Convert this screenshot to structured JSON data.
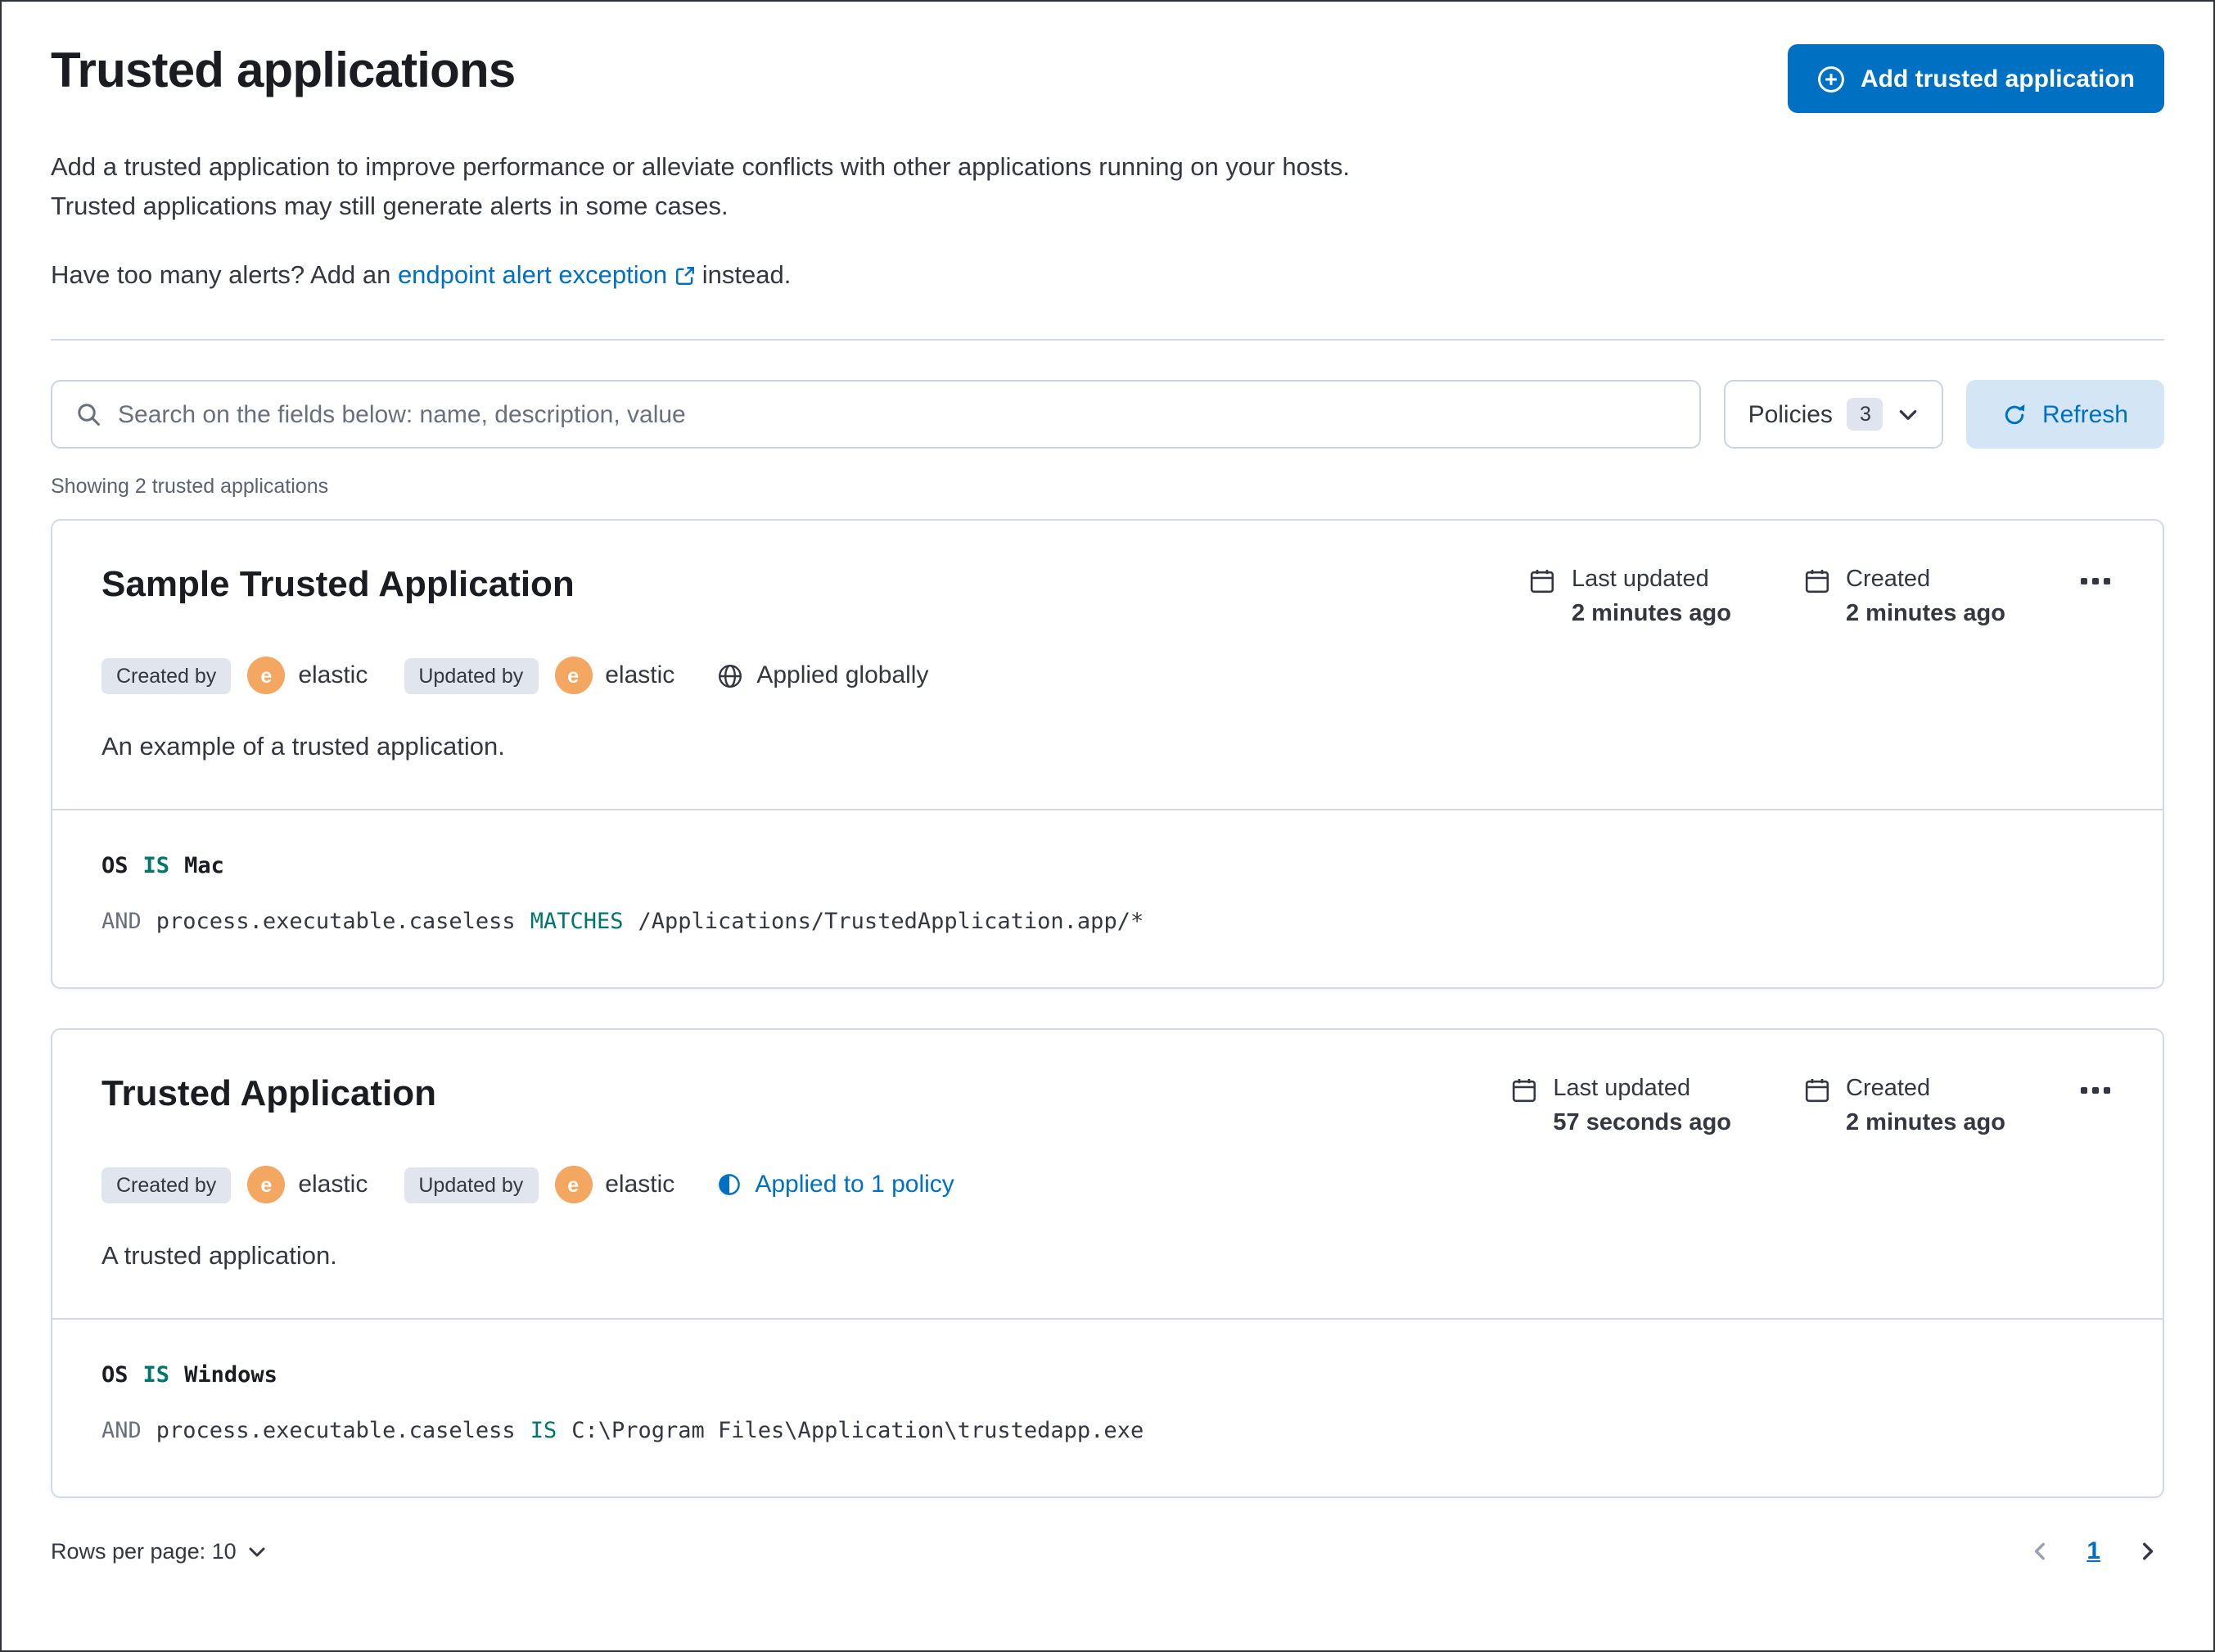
{
  "header": {
    "title": "Trusted applications",
    "add_button_label": "Add trusted application",
    "description": "Add a trusted application to improve performance or alleviate conflicts with other applications running on your hosts. Trusted applications may still generate alerts in some cases.",
    "alerts_line": {
      "prefix": "Have too many alerts? Add an ",
      "link_label": "endpoint alert exception",
      "suffix": " instead."
    }
  },
  "toolbar": {
    "search_placeholder": "Search on the fields below: name, description, value",
    "policies_label": "Policies",
    "policies_count": "3",
    "refresh_label": "Refresh"
  },
  "list": {
    "showing_text": "Showing 2 trusted applications"
  },
  "cards": [
    {
      "title": "Sample Trusted Application",
      "created_by_label": "Created by",
      "created_by_initial": "e",
      "created_by_user": "elastic",
      "updated_by_label": "Updated by",
      "updated_by_initial": "e",
      "updated_by_user": "elastic",
      "scope_label": "Applied globally",
      "last_updated_label": "Last updated",
      "last_updated_value": "2 minutes ago",
      "created_label": "Created",
      "created_value": "2 minutes ago",
      "description": "An example of a trusted application.",
      "conditions": [
        {
          "prefix": "",
          "field": "OS",
          "operator": "IS",
          "value": "Mac"
        },
        {
          "prefix": "AND",
          "field": "process.executable.caseless",
          "operator": "MATCHES",
          "value": "/Applications/TrustedApplication.app/*"
        }
      ]
    },
    {
      "title": "Trusted Application",
      "created_by_label": "Created by",
      "created_by_initial": "e",
      "created_by_user": "elastic",
      "updated_by_label": "Updated by",
      "updated_by_initial": "e",
      "updated_by_user": "elastic",
      "scope_label": "Applied to 1 policy",
      "last_updated_label": "Last updated",
      "last_updated_value": "57 seconds ago",
      "created_label": "Created",
      "created_value": "2 minutes ago",
      "description": "A trusted application.",
      "conditions": [
        {
          "prefix": "",
          "field": "OS",
          "operator": "IS",
          "value": "Windows"
        },
        {
          "prefix": "AND",
          "field": "process.executable.caseless",
          "operator": "IS",
          "value": "C:\\Program Files\\Application\\trustedapp.exe"
        }
      ]
    }
  ],
  "footer": {
    "rows_per_page_label": "Rows per page: 10",
    "current_page": "1"
  },
  "colors": {
    "primary_button": "#0071c2",
    "link": "#0071c2",
    "refresh_background": "#d4e6f5",
    "badge_background": "#e0e5ee",
    "avatar_orange": "#f3a760",
    "operator_teal": "#00756b",
    "border": "#d3dae6",
    "text": "#343741",
    "heading": "#1a1c21"
  },
  "icons": {
    "add_button": "plus-in-circle-icon",
    "search": "search-icon",
    "policies": "chevron-down-icon",
    "refresh": "refresh-icon",
    "dates": "calendar-icon",
    "global_scope": "globe-icon",
    "policy_scope": "partial-policy-icon",
    "card_menu": "ellipsis-icon",
    "external_link": "external-link-icon",
    "pagination_prev": "chevron-left-icon",
    "pagination_next": "chevron-right-icon"
  }
}
